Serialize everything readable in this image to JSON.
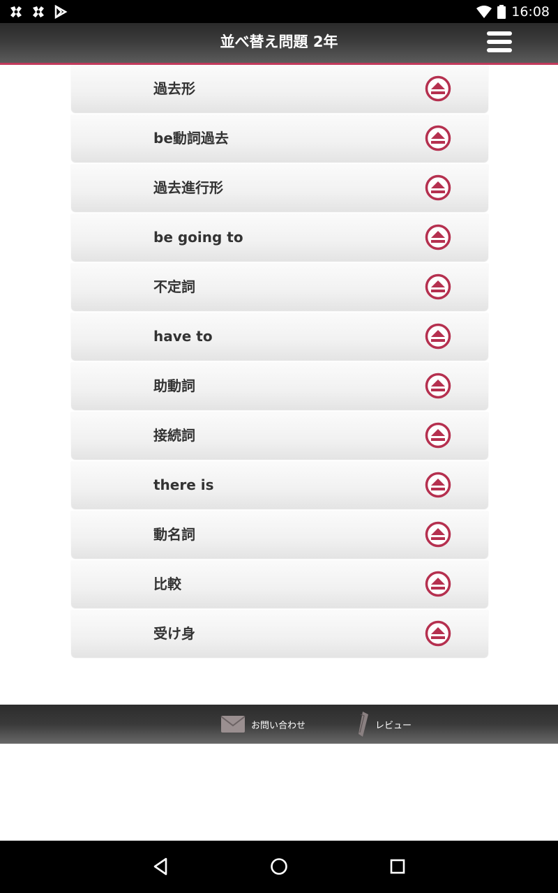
{
  "status_bar": {
    "time": "16:08"
  },
  "header": {
    "title": "並べ替え問題 2年"
  },
  "list": {
    "items": [
      {
        "label": "過去形"
      },
      {
        "label": "be動詞過去"
      },
      {
        "label": "過去進行形"
      },
      {
        "label": "be going to"
      },
      {
        "label": "不定詞"
      },
      {
        "label": "have to"
      },
      {
        "label": "助動詞"
      },
      {
        "label": "接続詞"
      },
      {
        "label": "there is"
      },
      {
        "label": "動名詞"
      },
      {
        "label": "比較"
      },
      {
        "label": "受け身"
      }
    ]
  },
  "footer": {
    "contact_label": "お問い合わせ",
    "review_label": "レビュー"
  },
  "colors": {
    "accent": "#b5304f",
    "header_border": "#c23a5c"
  }
}
